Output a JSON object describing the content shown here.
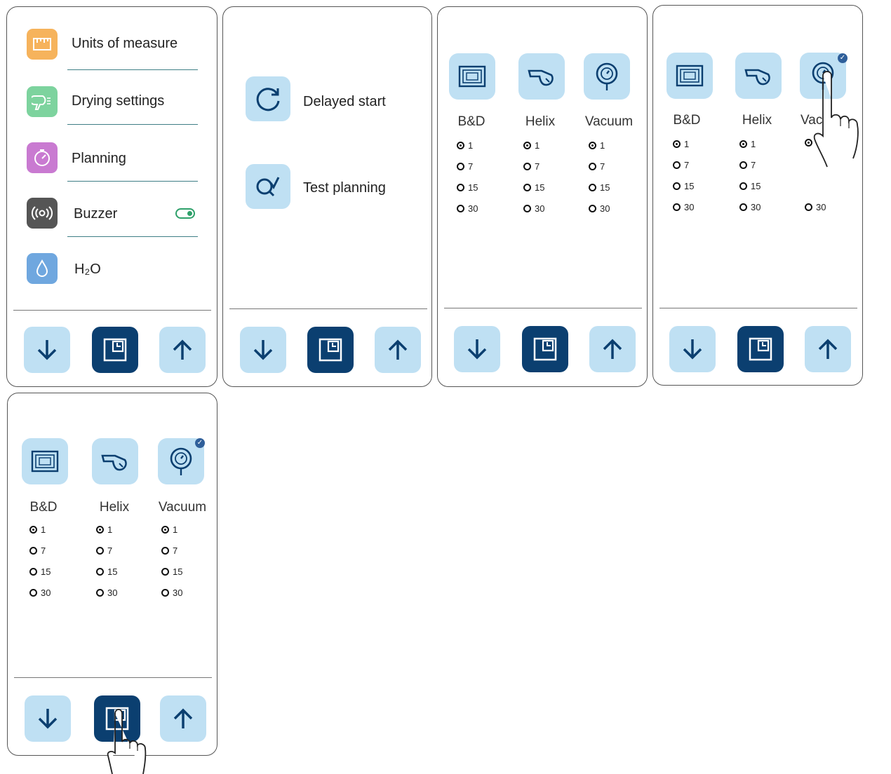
{
  "menu": {
    "items": [
      {
        "label": "Units of measure",
        "icon": "ruler-icon",
        "color": "#f6b35c"
      },
      {
        "label": "Drying settings",
        "icon": "hair-dryer-icon",
        "color": "#7dd39e"
      },
      {
        "label": "Planning",
        "icon": "timer-icon",
        "color": "#c97ad1"
      },
      {
        "label": "Buzzer",
        "icon": "buzzer-icon",
        "color": "#555555",
        "toggle": "on"
      },
      {
        "label": "H₂O",
        "icon": "water-drop-icon",
        "color": "#6fa7df"
      }
    ]
  },
  "planning": {
    "items": [
      {
        "label": "Delayed start",
        "icon": "delayed-start-icon"
      },
      {
        "label": "Test planning",
        "icon": "test-planning-icon"
      }
    ]
  },
  "cycles": {
    "columns": [
      {
        "name": "B&D",
        "icon": "bowie-dick-icon"
      },
      {
        "name": "Helix",
        "icon": "helix-icon"
      },
      {
        "name": "Vacuum",
        "icon": "vacuum-icon"
      }
    ],
    "options": [
      "1",
      "7",
      "15",
      "30"
    ],
    "selected_option": "1",
    "panel4_truncated_name": "Vac",
    "selected_column": "Vacuum"
  },
  "footer": {
    "down_icon": "arrow-down-icon",
    "center_icon": "confirm-icon",
    "up_icon": "arrow-up-icon"
  },
  "colors": {
    "button_light": "#bfe0f3",
    "button_dark": "#0b3f70",
    "accent_green": "#2ea06a"
  }
}
